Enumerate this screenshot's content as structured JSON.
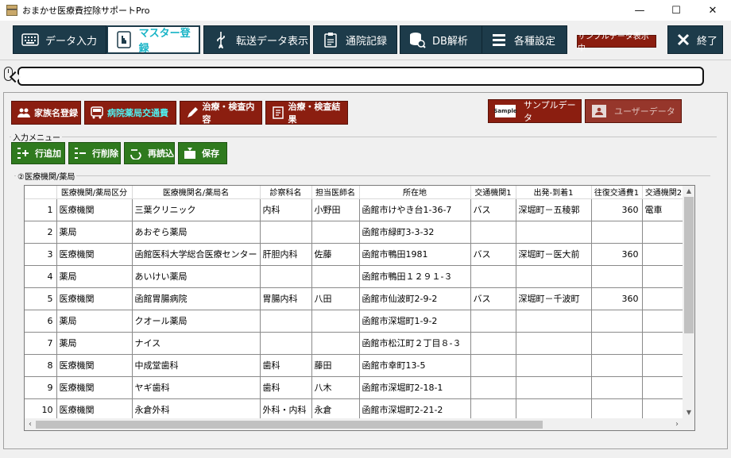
{
  "window": {
    "title": "おまかせ医療費控除サポートPro",
    "minimize": "—",
    "maximize": "☐",
    "close": "✕"
  },
  "mainbar": {
    "buttons": [
      {
        "label": "データ入力",
        "icon": "keyboard-icon"
      },
      {
        "label": "マスター登録",
        "icon": "list-hand-icon"
      },
      {
        "label": "転送データ表示",
        "icon": "usb-icon"
      },
      {
        "label": "通院記録",
        "icon": "clipboard-icon"
      },
      {
        "label": "DB解析",
        "icon": "database-search-icon"
      },
      {
        "label": "各種設定",
        "icon": "menu-icon"
      }
    ],
    "sample_badge": "サンプルデータ表示中",
    "exit_label": "終了"
  },
  "subtabs": [
    "家族名登録",
    "病院薬局交通費",
    "治療・検査内容",
    "治療・検査結果"
  ],
  "datasource": {
    "sample": "サンプルデータ",
    "sample_icon_text": "Sample",
    "user": "ユーザーデータ"
  },
  "input_menu": {
    "label": "入力メニュー",
    "buttons": [
      "行追加",
      "行削除",
      "再読込",
      "保存"
    ]
  },
  "grid": {
    "label": "②医療機関/薬局",
    "columns": [
      "医療機関/薬局区分",
      "医療機関名/薬局名",
      "診察科名",
      "担当医師名",
      "所在地",
      "交通機関1",
      "出発-到着1",
      "往復交通費1",
      "交通機関2"
    ],
    "rows": [
      {
        "no": "1",
        "cells": [
          "医療機関",
          "三葉クリニック",
          "内科",
          "小野田",
          "函館市けやき台1-36-7",
          "バス",
          "深堀町－五稜郭",
          "360",
          "電車"
        ]
      },
      {
        "no": "2",
        "cells": [
          "薬局",
          "あおぞら薬局",
          "",
          "",
          "函館市緑町3-3-32",
          "",
          "",
          "",
          ""
        ]
      },
      {
        "no": "3",
        "cells": [
          "医療機関",
          "函館医科大学総合医療センター",
          "肝胆内科",
          "佐藤",
          "函館市鴨田1981",
          "バス",
          "深堀町－医大前",
          "360",
          ""
        ]
      },
      {
        "no": "4",
        "cells": [
          "薬局",
          "あいけい薬局",
          "",
          "",
          "函館市鴨田１２９１-３",
          "",
          "",
          "",
          ""
        ]
      },
      {
        "no": "5",
        "cells": [
          "医療機関",
          "函館胃腸病院",
          "胃腸内科",
          "八田",
          "函館市仙波町2-9-2",
          "バス",
          "深堀町－千波町",
          "360",
          ""
        ]
      },
      {
        "no": "6",
        "cells": [
          "薬局",
          "クオール薬局",
          "",
          "",
          "函館市深堀町1-9-2",
          "",
          "",
          "",
          ""
        ]
      },
      {
        "no": "7",
        "cells": [
          "薬局",
          "ナイス",
          "",
          "",
          "函館市松江町２丁目８-３",
          "",
          "",
          "",
          ""
        ]
      },
      {
        "no": "8",
        "cells": [
          "医療機関",
          "中成堂歯科",
          "歯科",
          "藤田",
          "函館市幸町13-5",
          "",
          "",
          "",
          ""
        ]
      },
      {
        "no": "9",
        "cells": [
          "医療機関",
          "ヤギ歯科",
          "歯科",
          "八木",
          "函館市深堀町2-18-1",
          "",
          "",
          "",
          ""
        ]
      },
      {
        "no": "10",
        "cells": [
          "医療機関",
          "永倉外科",
          "外科・内科",
          "永倉",
          "函館市深堀町2-21-2",
          "",
          "",
          "",
          ""
        ]
      }
    ]
  },
  "colors": {
    "navy": "#1d3b4a",
    "maroon": "#8b1e10",
    "green": "#2f7a1e",
    "cyan": "#19b4c6"
  }
}
